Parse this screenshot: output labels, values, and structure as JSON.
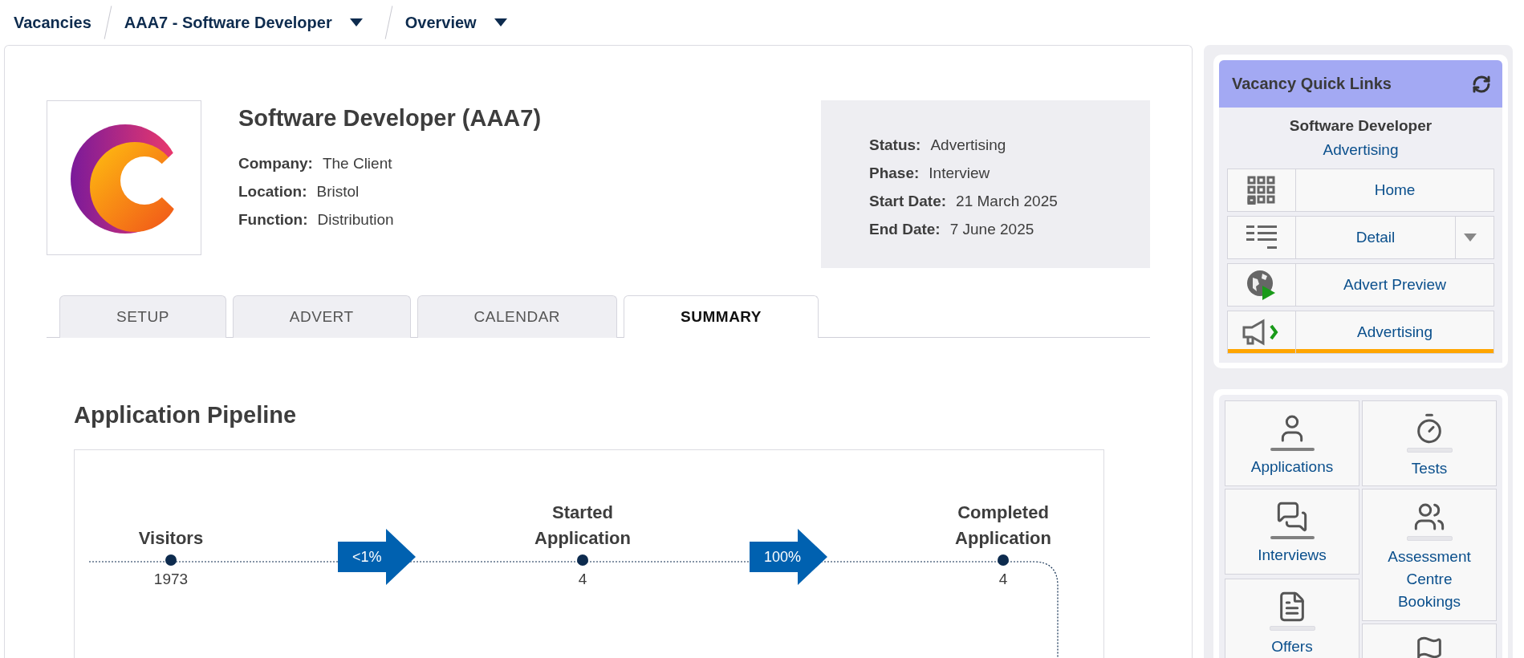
{
  "breadcrumbs": [
    {
      "label": "Vacancies",
      "dropdown": false
    },
    {
      "label": "AAA7 - Software Developer",
      "dropdown": true
    },
    {
      "label": "Overview",
      "dropdown": true
    }
  ],
  "vacancy": {
    "title": "Software Developer (AAA7)",
    "details": [
      {
        "label": "Company:",
        "value": "The Client"
      },
      {
        "label": "Location:",
        "value": "Bristol"
      },
      {
        "label": "Function:",
        "value": "Distribution"
      }
    ],
    "status": [
      {
        "label": "Status:",
        "value": "Advertising"
      },
      {
        "label": "Phase:",
        "value": "Interview"
      },
      {
        "label": "Start Date:",
        "value": "21 March 2025"
      },
      {
        "label": "End Date:",
        "value": "7 June 2025"
      }
    ]
  },
  "tabs": [
    {
      "label": "SETUP",
      "selected": false
    },
    {
      "label": "ADVERT",
      "selected": false
    },
    {
      "label": "CALENDAR",
      "selected": false
    },
    {
      "label": "SUMMARY",
      "selected": true
    }
  ],
  "pipeline": {
    "title": "Application Pipeline",
    "stages": [
      {
        "label": "Visitors",
        "value": "1973"
      },
      {
        "label": "Started Application",
        "value": "4"
      },
      {
        "label": "Completed Application",
        "value": "4"
      }
    ],
    "conversions": [
      "<1%",
      "100%"
    ]
  },
  "quick_links": {
    "title": "Vacancy Quick Links",
    "name": "Software Developer",
    "status": "Advertising",
    "links": [
      {
        "kind": "home",
        "label": "Home",
        "dropdown": false,
        "selected": false
      },
      {
        "kind": "detail",
        "label": "Detail",
        "dropdown": true,
        "selected": false
      },
      {
        "kind": "preview",
        "label": "Advert Preview",
        "dropdown": false,
        "selected": false
      },
      {
        "kind": "advertising",
        "label": "Advertising",
        "dropdown": false,
        "selected": true
      }
    ]
  },
  "tiles": [
    {
      "kind": "applications",
      "label": "Applications",
      "active": true
    },
    {
      "kind": "tests",
      "label": "Tests",
      "active": false
    },
    {
      "kind": "interviews",
      "label": "Interviews",
      "active": true
    },
    {
      "kind": "assessment",
      "label": "Assessment Centre Bookings",
      "active": false
    },
    {
      "kind": "offers",
      "label": "Offers",
      "active": false
    },
    {
      "kind": "flag"
    }
  ]
}
